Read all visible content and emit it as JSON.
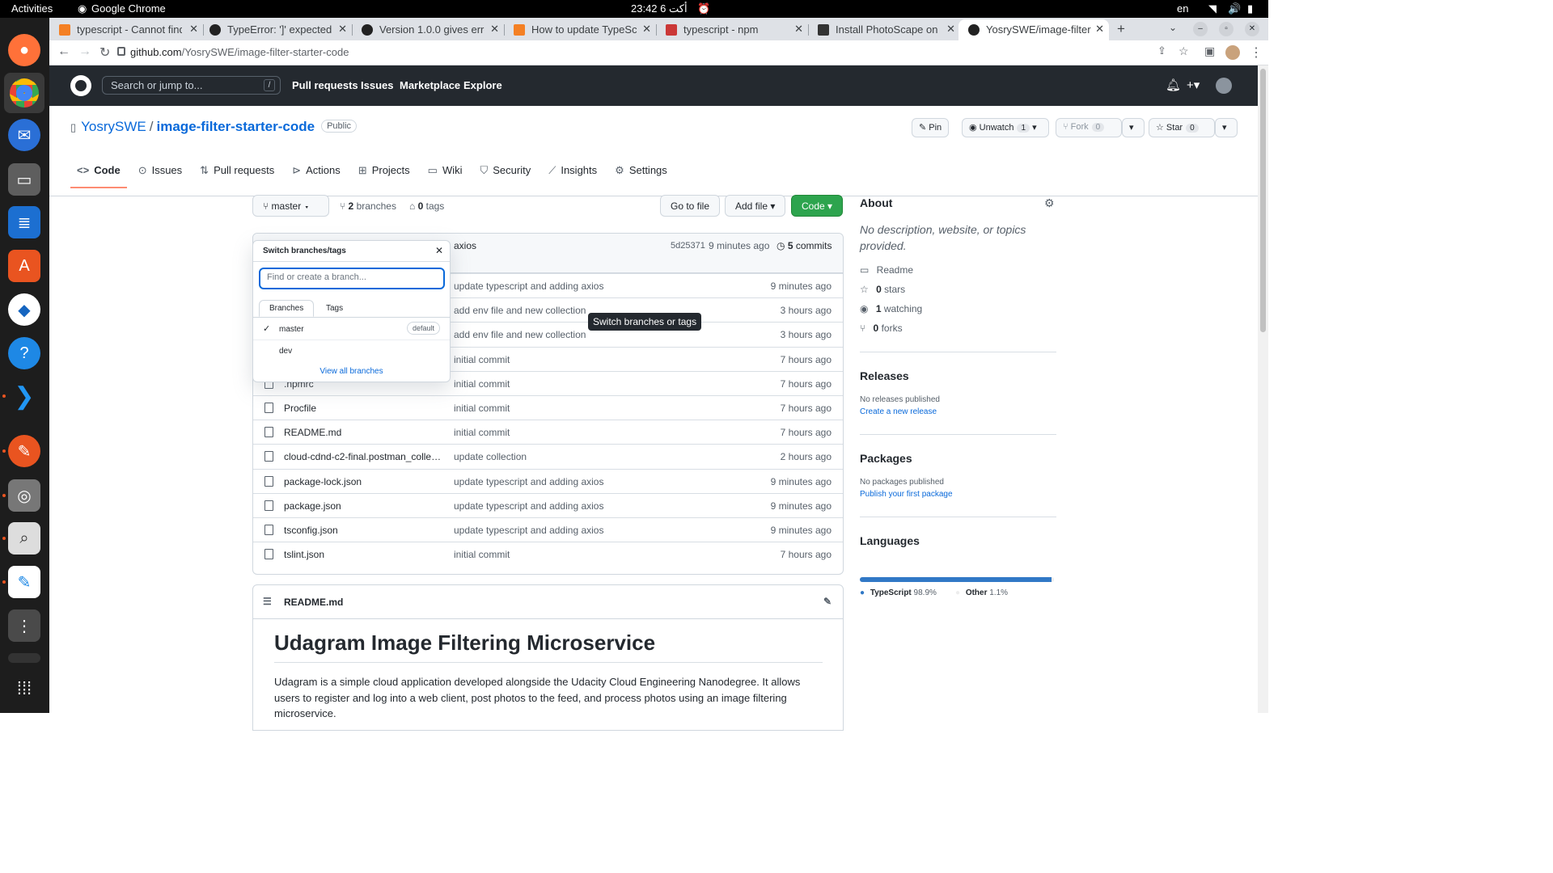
{
  "os": {
    "activities": "Activities",
    "app_name": "Google Chrome",
    "clock": "23:42  6 أكت",
    "lang": "en"
  },
  "browser": {
    "tabs": [
      {
        "title": "typescript - Cannot find"
      },
      {
        "title": "TypeError: ']' expected ("
      },
      {
        "title": "Version 1.0.0 gives error"
      },
      {
        "title": "How to update TypeScri"
      },
      {
        "title": "typescript - npm"
      },
      {
        "title": "Install PhotoScape on Li"
      },
      {
        "title": "YosrySWE/image-filter-"
      }
    ],
    "url_host": "github.com",
    "url_path": "/YosrySWE/image-filter-starter-code"
  },
  "gh": {
    "search_placeholder": "Search or jump to...",
    "search_key": "/",
    "nav": [
      "Pull requests",
      "Issues",
      "Marketplace",
      "Explore"
    ]
  },
  "repo": {
    "owner": "YosrySWE",
    "sep": "/",
    "name": "image-filter-starter-code",
    "visibility": "Public",
    "pin": "Pin",
    "unwatch": "Unwatch",
    "unwatch_count": "1",
    "fork": "Fork",
    "fork_count": "0",
    "star": "Star",
    "star_count": "0",
    "tabs": [
      "Code",
      "Issues",
      "Pull requests",
      "Actions",
      "Projects",
      "Wiki",
      "Security",
      "Insights",
      "Settings"
    ]
  },
  "main": {
    "branch": "master",
    "branches_count": "2",
    "branches_label": "branches",
    "tags_count": "0",
    "tags_label": "tags",
    "go_to_file": "Go to file",
    "add_file": "Add file",
    "code": "Code",
    "commit_msg_tail": "axios",
    "commit_hash": "5d25371",
    "commit_time": "9 minutes ago",
    "commits_count": "5",
    "commits_label": "commits",
    "files": [
      {
        "name": "",
        "msg": "update typescript and adding axios",
        "time": "9 minutes ago"
      },
      {
        "name": "",
        "msg": "add env file and new collection",
        "time": "3 hours ago"
      },
      {
        "name": "",
        "msg": "add env file and new collection",
        "time": "3 hours ago"
      },
      {
        "name": "",
        "msg": "initial commit",
        "time": "7 hours ago"
      },
      {
        "name": ".npmrc",
        "msg": "initial commit",
        "time": "7 hours ago"
      },
      {
        "name": "Procfile",
        "msg": "initial commit",
        "time": "7 hours ago"
      },
      {
        "name": "README.md",
        "msg": "initial commit",
        "time": "7 hours ago"
      },
      {
        "name": "cloud-cdnd-c2-final.postman_collecti...",
        "msg": "update collection",
        "time": "2 hours ago"
      },
      {
        "name": "package-lock.json",
        "msg": "update typescript and adding axios",
        "time": "9 minutes ago"
      },
      {
        "name": "package.json",
        "msg": "update typescript and adding axios",
        "time": "9 minutes ago"
      },
      {
        "name": "tsconfig.json",
        "msg": "update typescript and adding axios",
        "time": "9 minutes ago"
      },
      {
        "name": "tslint.json",
        "msg": "initial commit",
        "time": "7 hours ago"
      }
    ],
    "readme_file": "README.md",
    "readme_title": "Udagram Image Filtering Microservice",
    "readme_body": "Udagram is a simple cloud application developed alongside the Udacity Cloud Engineering Nanodegree. It allows users to register and log into a web client, post photos to the feed, and process photos using an image filtering microservice."
  },
  "dropdown": {
    "title": "Switch branches/tags",
    "placeholder": "Find or create a branch...",
    "tab_branches": "Branches",
    "tab_tags": "Tags",
    "branches": [
      {
        "name": "master",
        "badge": "default"
      },
      {
        "name": "dev",
        "badge": ""
      }
    ],
    "view_all": "View all branches"
  },
  "tooltip": "Switch branches or tags",
  "sidebar": {
    "about": "About",
    "description": "No description, website, or topics provided.",
    "readme": "Readme",
    "stars_count": "0",
    "stars_label": "stars",
    "watching_count": "1",
    "watching_label": "watching",
    "forks_count": "0",
    "forks_label": "forks",
    "releases": "Releases",
    "no_releases": "No releases published",
    "create_release": "Create a new release",
    "packages": "Packages",
    "no_packages": "No packages published",
    "publish_package": "Publish your first package",
    "languages": "Languages",
    "langs": [
      {
        "name": "TypeScript",
        "pct": "98.9%",
        "color": "#3178c6",
        "value": 98.9
      },
      {
        "name": "Other",
        "pct": "1.1%",
        "color": "#ededed",
        "value": 1.1
      }
    ]
  }
}
